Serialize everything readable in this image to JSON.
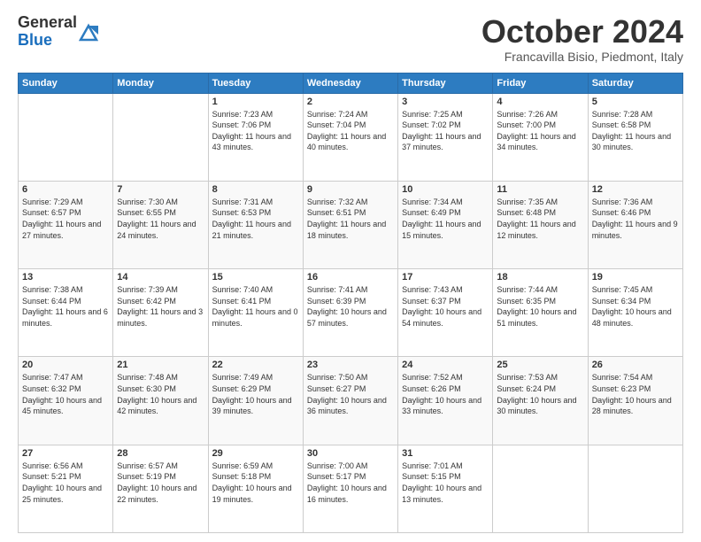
{
  "header": {
    "logo_general": "General",
    "logo_blue": "Blue",
    "month": "October 2024",
    "location": "Francavilla Bisio, Piedmont, Italy"
  },
  "weekdays": [
    "Sunday",
    "Monday",
    "Tuesday",
    "Wednesday",
    "Thursday",
    "Friday",
    "Saturday"
  ],
  "weeks": [
    [
      {
        "day": "",
        "info": ""
      },
      {
        "day": "",
        "info": ""
      },
      {
        "day": "1",
        "info": "Sunrise: 7:23 AM\nSunset: 7:06 PM\nDaylight: 11 hours and 43 minutes."
      },
      {
        "day": "2",
        "info": "Sunrise: 7:24 AM\nSunset: 7:04 PM\nDaylight: 11 hours and 40 minutes."
      },
      {
        "day": "3",
        "info": "Sunrise: 7:25 AM\nSunset: 7:02 PM\nDaylight: 11 hours and 37 minutes."
      },
      {
        "day": "4",
        "info": "Sunrise: 7:26 AM\nSunset: 7:00 PM\nDaylight: 11 hours and 34 minutes."
      },
      {
        "day": "5",
        "info": "Sunrise: 7:28 AM\nSunset: 6:58 PM\nDaylight: 11 hours and 30 minutes."
      }
    ],
    [
      {
        "day": "6",
        "info": "Sunrise: 7:29 AM\nSunset: 6:57 PM\nDaylight: 11 hours and 27 minutes."
      },
      {
        "day": "7",
        "info": "Sunrise: 7:30 AM\nSunset: 6:55 PM\nDaylight: 11 hours and 24 minutes."
      },
      {
        "day": "8",
        "info": "Sunrise: 7:31 AM\nSunset: 6:53 PM\nDaylight: 11 hours and 21 minutes."
      },
      {
        "day": "9",
        "info": "Sunrise: 7:32 AM\nSunset: 6:51 PM\nDaylight: 11 hours and 18 minutes."
      },
      {
        "day": "10",
        "info": "Sunrise: 7:34 AM\nSunset: 6:49 PM\nDaylight: 11 hours and 15 minutes."
      },
      {
        "day": "11",
        "info": "Sunrise: 7:35 AM\nSunset: 6:48 PM\nDaylight: 11 hours and 12 minutes."
      },
      {
        "day": "12",
        "info": "Sunrise: 7:36 AM\nSunset: 6:46 PM\nDaylight: 11 hours and 9 minutes."
      }
    ],
    [
      {
        "day": "13",
        "info": "Sunrise: 7:38 AM\nSunset: 6:44 PM\nDaylight: 11 hours and 6 minutes."
      },
      {
        "day": "14",
        "info": "Sunrise: 7:39 AM\nSunset: 6:42 PM\nDaylight: 11 hours and 3 minutes."
      },
      {
        "day": "15",
        "info": "Sunrise: 7:40 AM\nSunset: 6:41 PM\nDaylight: 11 hours and 0 minutes."
      },
      {
        "day": "16",
        "info": "Sunrise: 7:41 AM\nSunset: 6:39 PM\nDaylight: 10 hours and 57 minutes."
      },
      {
        "day": "17",
        "info": "Sunrise: 7:43 AM\nSunset: 6:37 PM\nDaylight: 10 hours and 54 minutes."
      },
      {
        "day": "18",
        "info": "Sunrise: 7:44 AM\nSunset: 6:35 PM\nDaylight: 10 hours and 51 minutes."
      },
      {
        "day": "19",
        "info": "Sunrise: 7:45 AM\nSunset: 6:34 PM\nDaylight: 10 hours and 48 minutes."
      }
    ],
    [
      {
        "day": "20",
        "info": "Sunrise: 7:47 AM\nSunset: 6:32 PM\nDaylight: 10 hours and 45 minutes."
      },
      {
        "day": "21",
        "info": "Sunrise: 7:48 AM\nSunset: 6:30 PM\nDaylight: 10 hours and 42 minutes."
      },
      {
        "day": "22",
        "info": "Sunrise: 7:49 AM\nSunset: 6:29 PM\nDaylight: 10 hours and 39 minutes."
      },
      {
        "day": "23",
        "info": "Sunrise: 7:50 AM\nSunset: 6:27 PM\nDaylight: 10 hours and 36 minutes."
      },
      {
        "day": "24",
        "info": "Sunrise: 7:52 AM\nSunset: 6:26 PM\nDaylight: 10 hours and 33 minutes."
      },
      {
        "day": "25",
        "info": "Sunrise: 7:53 AM\nSunset: 6:24 PM\nDaylight: 10 hours and 30 minutes."
      },
      {
        "day": "26",
        "info": "Sunrise: 7:54 AM\nSunset: 6:23 PM\nDaylight: 10 hours and 28 minutes."
      }
    ],
    [
      {
        "day": "27",
        "info": "Sunrise: 6:56 AM\nSunset: 5:21 PM\nDaylight: 10 hours and 25 minutes."
      },
      {
        "day": "28",
        "info": "Sunrise: 6:57 AM\nSunset: 5:19 PM\nDaylight: 10 hours and 22 minutes."
      },
      {
        "day": "29",
        "info": "Sunrise: 6:59 AM\nSunset: 5:18 PM\nDaylight: 10 hours and 19 minutes."
      },
      {
        "day": "30",
        "info": "Sunrise: 7:00 AM\nSunset: 5:17 PM\nDaylight: 10 hours and 16 minutes."
      },
      {
        "day": "31",
        "info": "Sunrise: 7:01 AM\nSunset: 5:15 PM\nDaylight: 10 hours and 13 minutes."
      },
      {
        "day": "",
        "info": ""
      },
      {
        "day": "",
        "info": ""
      }
    ]
  ]
}
